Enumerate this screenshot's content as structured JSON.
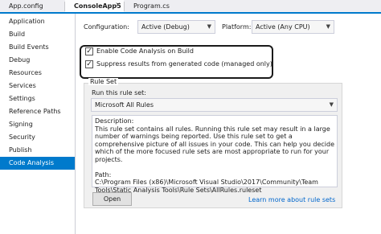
{
  "tabs": [
    {
      "label": "App.config",
      "active": false
    },
    {
      "label": "ConsoleApp5",
      "active": true
    },
    {
      "label": "Program.cs",
      "active": false
    }
  ],
  "tab_close_glyph": "×",
  "sidebar": {
    "items": [
      {
        "label": "Application"
      },
      {
        "label": "Build"
      },
      {
        "label": "Build Events"
      },
      {
        "label": "Debug"
      },
      {
        "label": "Resources"
      },
      {
        "label": "Services"
      },
      {
        "label": "Settings"
      },
      {
        "label": "Reference Paths"
      },
      {
        "label": "Signing"
      },
      {
        "label": "Security"
      },
      {
        "label": "Publish"
      },
      {
        "label": "Code Analysis",
        "selected": true
      }
    ]
  },
  "config": {
    "configuration_label": "Configuration:",
    "configuration_value": "Active (Debug)",
    "platform_label": "Platform:",
    "platform_value": "Active (Any CPU)"
  },
  "options": {
    "enable_label": "Enable Code Analysis on Build",
    "enable_checked": true,
    "suppress_label": "Suppress results from generated code (managed only)",
    "suppress_checked": true
  },
  "ruleset": {
    "group_title": "Rule Set",
    "run_label": "Run this rule set:",
    "selected": "Microsoft All Rules",
    "description_heading": "Description:",
    "description_text": "This rule set contains all rules. Running this rule set may result in a large number of warnings being reported. Use this rule set to get a comprehensive picture of all issues in your code. This can help you decide which of the more focused rule sets are most appropriate to run for your projects.",
    "path_heading": "Path:",
    "path_value": "C:\\Program Files (x86)\\Microsoft Visual Studio\\2017\\Community\\Team Tools\\Static Analysis Tools\\Rule Sets\\AllRules.ruleset",
    "open_button": "Open",
    "learn_more": "Learn more about rule sets"
  },
  "colors": {
    "accent": "#007acc",
    "link": "#0066cc",
    "group_background": "#f0f0f0"
  }
}
